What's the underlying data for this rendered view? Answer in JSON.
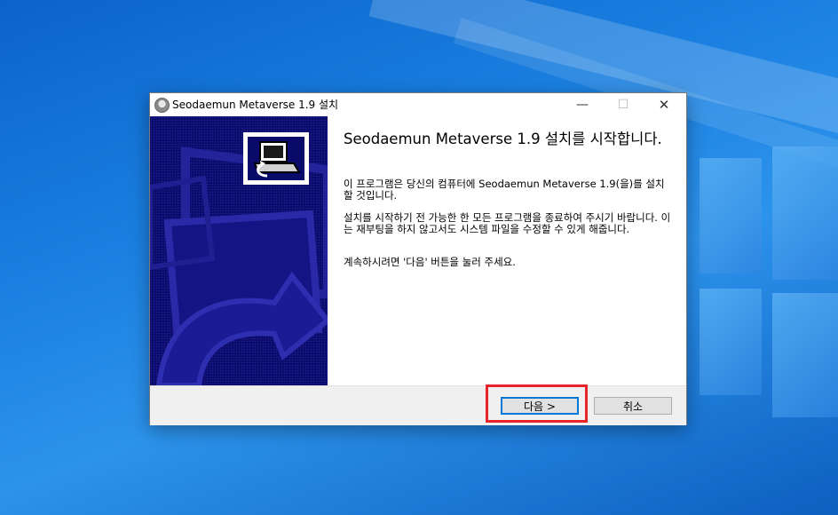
{
  "window": {
    "title": "Seodaemun Metaverse 1.9 설치",
    "controls": {
      "minimize": "—",
      "maximize": "☐",
      "close": "✕"
    }
  },
  "content": {
    "heading": "Seodaemun Metaverse 1.9 설치를 시작합니다.",
    "paragraphs": [
      "이 프로그램은 당신의 컴퓨터에 Seodaemun Metaverse 1.9(을)를 설치할 것입니다.",
      "설치를 시작하기 전 가능한 한 모든 프로그램을 종료하여 주시기 바랍니다. 이는 재부팅을 하지 않고서도 시스템 파일을 수정할 수 있게 해줍니다.",
      "계속하시려면 '다음' 버튼을 눌러 주세요."
    ]
  },
  "buttons": {
    "next": "다음 >",
    "cancel": "취소"
  },
  "icons": {
    "app": "installer-app-icon",
    "banner": "installer-computer-icon"
  },
  "colors": {
    "banner_bg": "#0a0a6a",
    "highlight": "#e8232a",
    "focus": "#0078d7"
  }
}
